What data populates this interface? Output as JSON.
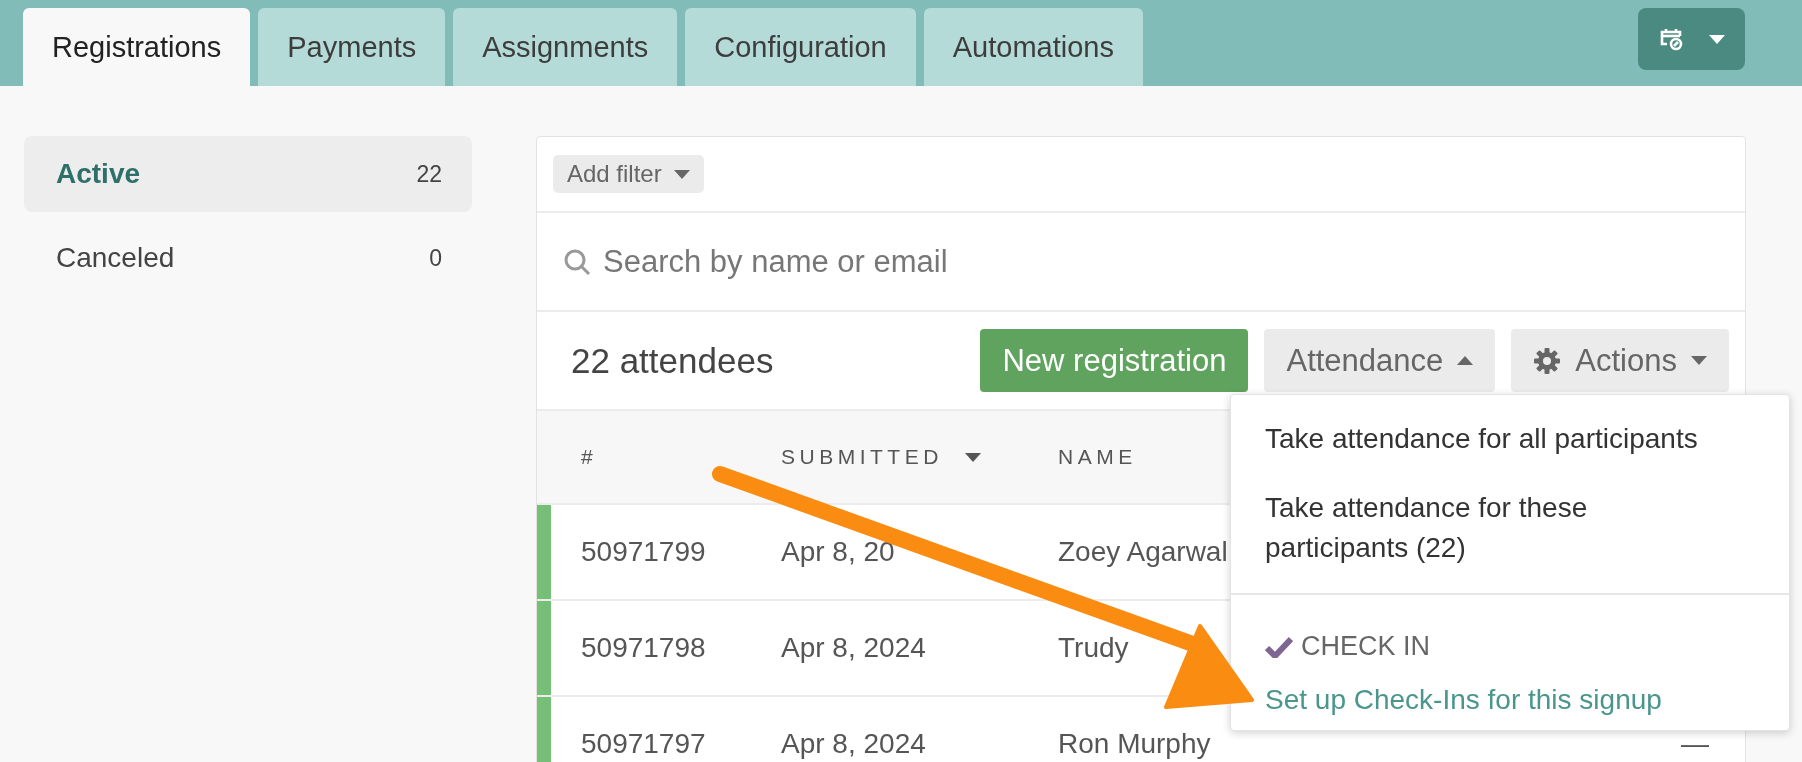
{
  "tabs": [
    {
      "label": "Registrations",
      "selected": true
    },
    {
      "label": "Payments",
      "selected": false
    },
    {
      "label": "Assignments",
      "selected": false
    },
    {
      "label": "Configuration",
      "selected": false
    },
    {
      "label": "Automations",
      "selected": false
    }
  ],
  "sidebar": {
    "items": [
      {
        "label": "Active",
        "count": "22",
        "selected": true
      },
      {
        "label": "Canceled",
        "count": "0",
        "selected": false
      }
    ]
  },
  "filter": {
    "label": "Add filter"
  },
  "search": {
    "placeholder": "Search by name or email"
  },
  "summary": "22 attendees",
  "buttons": [
    {
      "kind": "primary",
      "label": "New registration"
    },
    {
      "kind": "menu",
      "label": "Attendance",
      "expanded": true
    },
    {
      "kind": "settings-menu",
      "label": "Actions",
      "expanded": false
    }
  ],
  "table": {
    "columns": [
      {
        "label": "#",
        "sorted": false
      },
      {
        "label": "SUBMITTED",
        "sorted": true
      },
      {
        "label": "NAME",
        "sorted": false
      }
    ],
    "rows": [
      {
        "number": "50971799",
        "submitted": "Apr 8, 20",
        "name": "Zoey Agarwal"
      },
      {
        "number": "50971798",
        "submitted": "Apr 8, 2024",
        "name": "Trudy"
      },
      {
        "number": "50971797",
        "submitted": "Apr 8, 2024",
        "name": "Ron Murphy",
        "column_5": "—"
      }
    ]
  },
  "attendance_menu": {
    "items": [
      {
        "label": "Take attendance for all participants"
      },
      {
        "label": "Take attendance for these participants (22)"
      }
    ],
    "section_heading": "CHECK IN",
    "link": "Set up Check-Ins for this signup"
  }
}
